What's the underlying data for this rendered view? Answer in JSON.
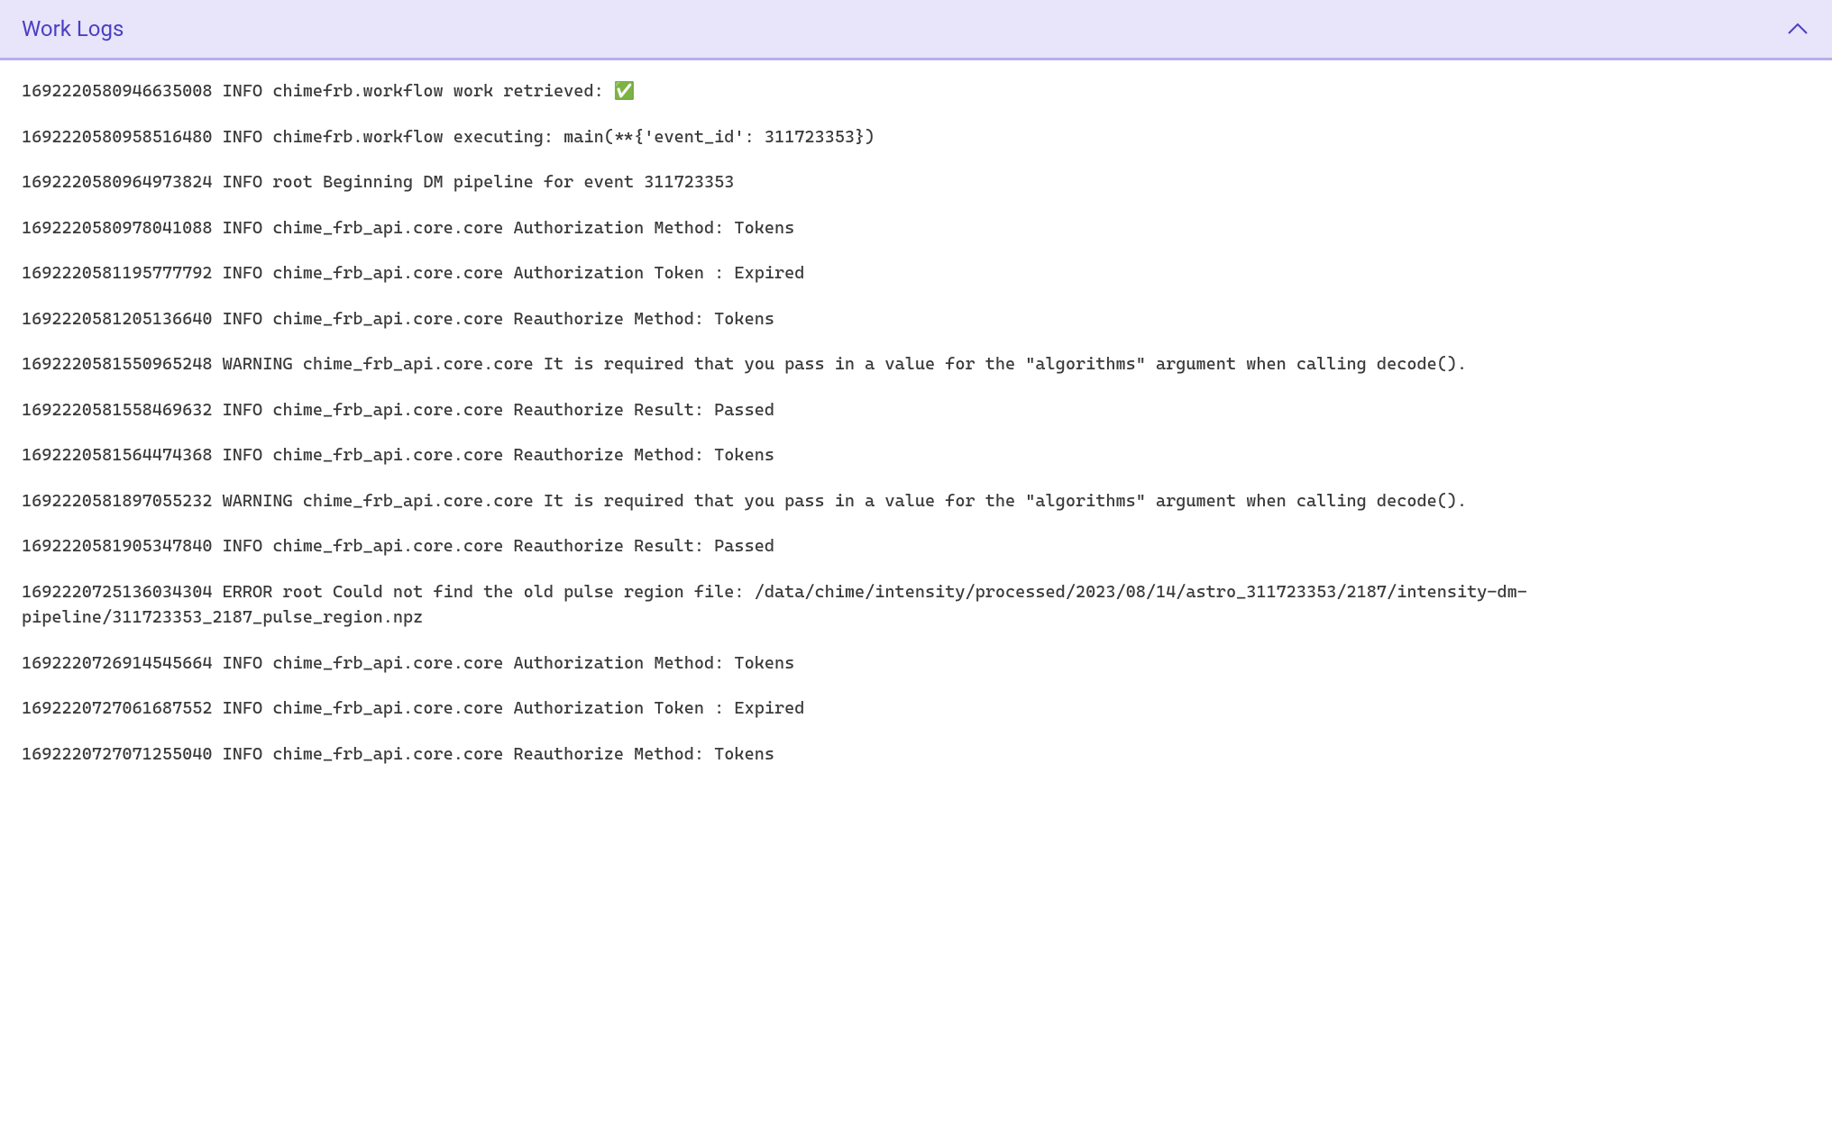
{
  "header": {
    "title": "Work Logs"
  },
  "logs": [
    "1692220580946635008 INFO chimefrb.workflow work retrieved: ✅",
    "1692220580958516480 INFO chimefrb.workflow executing: main(**{'event_id': 311723353})",
    "1692220580964973824 INFO root Beginning DM pipeline for event 311723353",
    "1692220580978041088 INFO chime_frb_api.core.core Authorization Method: Tokens",
    "1692220581195777792 INFO chime_frb_api.core.core Authorization Token : Expired",
    "1692220581205136640 INFO chime_frb_api.core.core Reauthorize Method: Tokens",
    "1692220581550965248 WARNING chime_frb_api.core.core It is required that you pass in a value for the \"algorithms\" argument when calling decode().",
    "1692220581558469632 INFO chime_frb_api.core.core Reauthorize Result: Passed",
    "1692220581564474368 INFO chime_frb_api.core.core Reauthorize Method: Tokens",
    "1692220581897055232 WARNING chime_frb_api.core.core It is required that you pass in a value for the \"algorithms\" argument when calling decode().",
    "1692220581905347840 INFO chime_frb_api.core.core Reauthorize Result: Passed",
    "1692220725136034304 ERROR root Could not find the old pulse region file: /data/chime/intensity/processed/2023/08/14/astro_311723353/2187/intensity-dm-pipeline/311723353_2187_pulse_region.npz",
    "1692220726914545664 INFO chime_frb_api.core.core Authorization Method: Tokens",
    "1692220727061687552 INFO chime_frb_api.core.core Authorization Token : Expired",
    "1692220727071255040 INFO chime_frb_api.core.core Reauthorize Method: Tokens"
  ]
}
